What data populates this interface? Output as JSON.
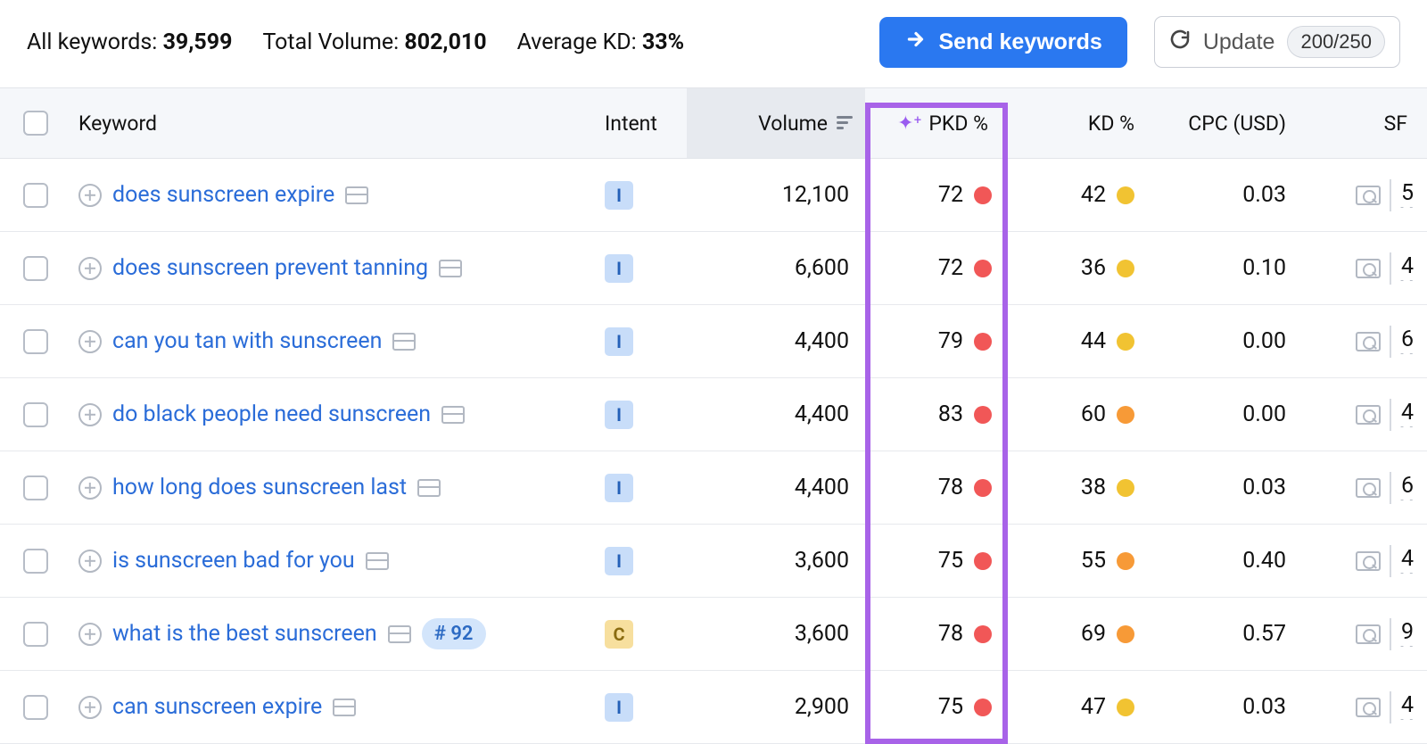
{
  "summary": {
    "all_keywords_label": "All keywords: ",
    "all_keywords_value": "39,599",
    "total_volume_label": "Total Volume: ",
    "total_volume_value": "802,010",
    "avg_kd_label": "Average KD: ",
    "avg_kd_value": "33%",
    "send_button": "Send keywords",
    "update_button": "Update",
    "update_count": "200/250"
  },
  "columns": {
    "keyword": "Keyword",
    "intent": "Intent",
    "volume": "Volume",
    "pkd": "PKD %",
    "kd": "KD %",
    "cpc": "CPC (USD)",
    "sf": "SF"
  },
  "rows": [
    {
      "keyword": "does sunscreen expire",
      "intent": "I",
      "volume": "12,100",
      "pkd": "72",
      "pkd_dot": "red",
      "kd": "42",
      "kd_dot": "yellow",
      "cpc": "0.03",
      "sf": "5",
      "rank": ""
    },
    {
      "keyword": "does sunscreen prevent tanning",
      "intent": "I",
      "volume": "6,600",
      "pkd": "72",
      "pkd_dot": "red",
      "kd": "36",
      "kd_dot": "yellow",
      "cpc": "0.10",
      "sf": "4",
      "rank": ""
    },
    {
      "keyword": "can you tan with sunscreen",
      "intent": "I",
      "volume": "4,400",
      "pkd": "79",
      "pkd_dot": "red",
      "kd": "44",
      "kd_dot": "yellow",
      "cpc": "0.00",
      "sf": "6",
      "rank": ""
    },
    {
      "keyword": "do black people need sunscreen",
      "intent": "I",
      "volume": "4,400",
      "pkd": "83",
      "pkd_dot": "red",
      "kd": "60",
      "kd_dot": "orange",
      "cpc": "0.00",
      "sf": "4",
      "rank": ""
    },
    {
      "keyword": "how long does sunscreen last",
      "intent": "I",
      "volume": "4,400",
      "pkd": "78",
      "pkd_dot": "red",
      "kd": "38",
      "kd_dot": "yellow",
      "cpc": "0.03",
      "sf": "6",
      "rank": ""
    },
    {
      "keyword": "is sunscreen bad for you",
      "intent": "I",
      "volume": "3,600",
      "pkd": "75",
      "pkd_dot": "red",
      "kd": "55",
      "kd_dot": "orange",
      "cpc": "0.40",
      "sf": "4",
      "rank": ""
    },
    {
      "keyword": "what is the best sunscreen",
      "intent": "C",
      "volume": "3,600",
      "pkd": "78",
      "pkd_dot": "red",
      "kd": "69",
      "kd_dot": "orange",
      "cpc": "0.57",
      "sf": "9",
      "rank": "# 92"
    },
    {
      "keyword": "can sunscreen expire",
      "intent": "I",
      "volume": "2,900",
      "pkd": "75",
      "pkd_dot": "red",
      "kd": "47",
      "kd_dot": "yellow",
      "cpc": "0.03",
      "sf": "4",
      "rank": ""
    }
  ]
}
